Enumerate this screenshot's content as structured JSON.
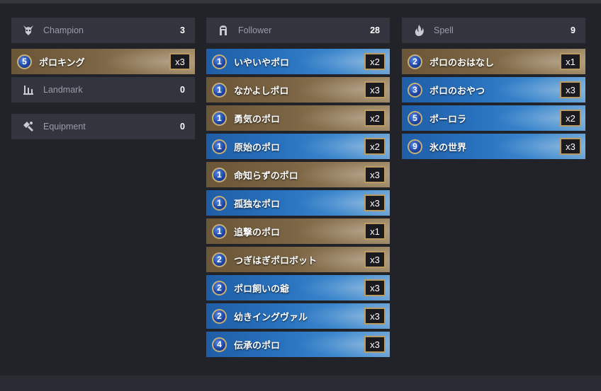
{
  "champion": {
    "header": {
      "title": "Champion",
      "count": "3",
      "icon": "champion-icon"
    },
    "cards": [
      {
        "cost": "5",
        "name": "ポロキング",
        "qty": "x3",
        "region": "gold"
      }
    ]
  },
  "landmark": {
    "header": {
      "title": "Landmark",
      "count": "0",
      "icon": "landmark-icon"
    }
  },
  "equipment": {
    "header": {
      "title": "Equipment",
      "count": "0",
      "icon": "equipment-icon"
    }
  },
  "follower": {
    "header": {
      "title": "Follower",
      "count": "28",
      "icon": "follower-icon"
    },
    "cards": [
      {
        "cost": "1",
        "name": "いやいやポロ",
        "qty": "x2",
        "region": "blue"
      },
      {
        "cost": "1",
        "name": "なかよしポロ",
        "qty": "x3",
        "region": "gold"
      },
      {
        "cost": "1",
        "name": "勇気のポロ",
        "qty": "x2",
        "region": "gold"
      },
      {
        "cost": "1",
        "name": "原始のポロ",
        "qty": "x2",
        "region": "blue"
      },
      {
        "cost": "1",
        "name": "命知らずのポロ",
        "qty": "x3",
        "region": "gold"
      },
      {
        "cost": "1",
        "name": "孤独なポロ",
        "qty": "x3",
        "region": "blue"
      },
      {
        "cost": "1",
        "name": "追撃のポロ",
        "qty": "x1",
        "region": "gold"
      },
      {
        "cost": "2",
        "name": "つぎはぎポロボット",
        "qty": "x3",
        "region": "gold"
      },
      {
        "cost": "2",
        "name": "ポロ飼いの爺",
        "qty": "x3",
        "region": "blue"
      },
      {
        "cost": "2",
        "name": "幼きイングヴァル",
        "qty": "x3",
        "region": "blue"
      },
      {
        "cost": "4",
        "name": "伝承のポロ",
        "qty": "x3",
        "region": "blue"
      }
    ]
  },
  "spell": {
    "header": {
      "title": "Spell",
      "count": "9",
      "icon": "spell-icon"
    },
    "cards": [
      {
        "cost": "2",
        "name": "ポロのおはなし",
        "qty": "x1",
        "region": "gold"
      },
      {
        "cost": "3",
        "name": "ポロのおやつ",
        "qty": "x3",
        "region": "blue"
      },
      {
        "cost": "5",
        "name": "ポーロラ",
        "qty": "x2",
        "region": "blue"
      },
      {
        "cost": "9",
        "name": "氷の世界",
        "qty": "x3",
        "region": "blue"
      }
    ]
  },
  "colors": {
    "background": "#222328",
    "header": "#32343e",
    "gold_card": "#7a6443",
    "blue_card": "#2a74c0",
    "qty_border": "#b89a62"
  }
}
